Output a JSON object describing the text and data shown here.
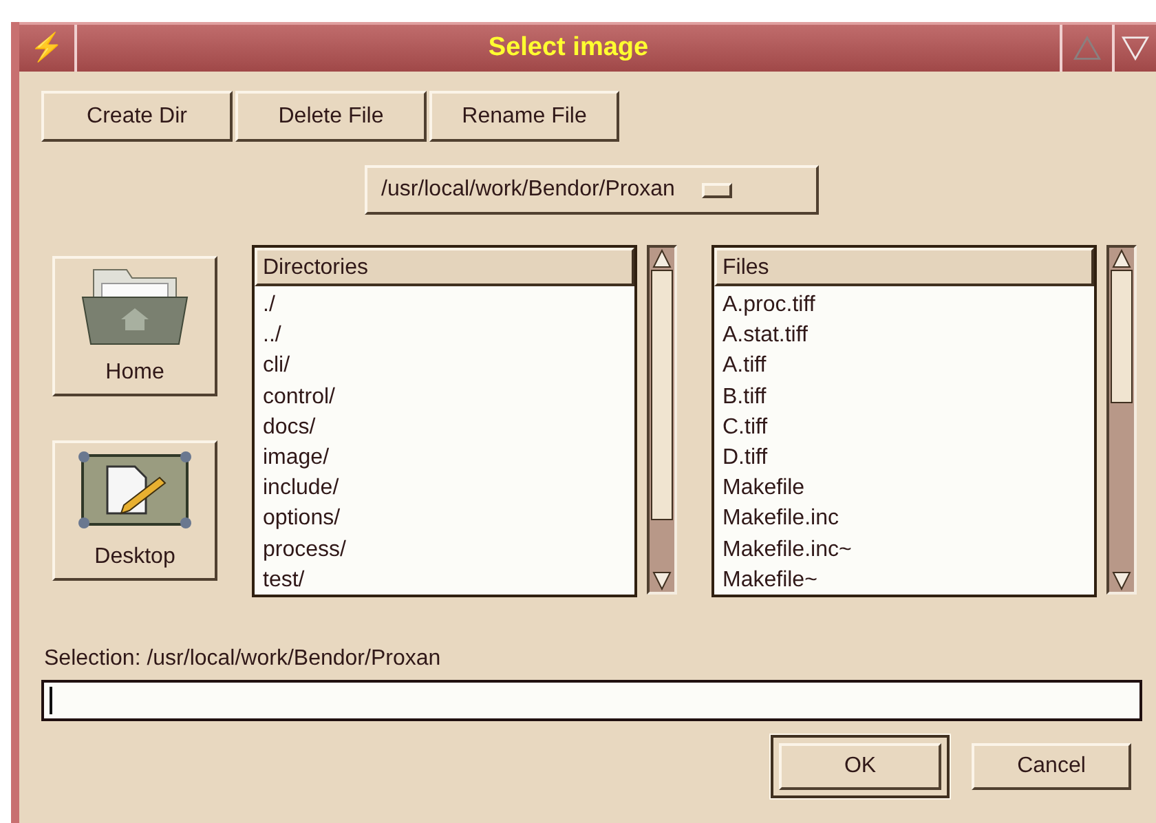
{
  "window": {
    "title": "Select image",
    "icon": "⚡"
  },
  "toolbar": [
    "Create Dir",
    "Delete File",
    "Rename File"
  ],
  "path_menu": {
    "value": "/usr/local/work/Bendor/Proxan"
  },
  "places": [
    {
      "label": "Home",
      "kind": "home"
    },
    {
      "label": "Desktop",
      "kind": "desktop"
    }
  ],
  "directories": {
    "header": "Directories",
    "items": [
      "./",
      "../",
      "cli/",
      "control/",
      "docs/",
      "image/",
      "include/",
      "options/",
      "process/",
      "test/"
    ]
  },
  "files": {
    "header": "Files",
    "items": [
      "A.proc.tiff",
      "A.stat.tiff",
      "A.tiff",
      "B.tiff",
      "C.tiff",
      "D.tiff",
      "Makefile",
      "Makefile.inc",
      "Makefile.inc~",
      "Makefile~"
    ]
  },
  "selection": {
    "label": "Selection: /usr/local/work/Bendor/Proxan"
  },
  "buttons": [
    {
      "label": "OK",
      "default": true
    },
    {
      "label": "Cancel",
      "default": false
    }
  ]
}
